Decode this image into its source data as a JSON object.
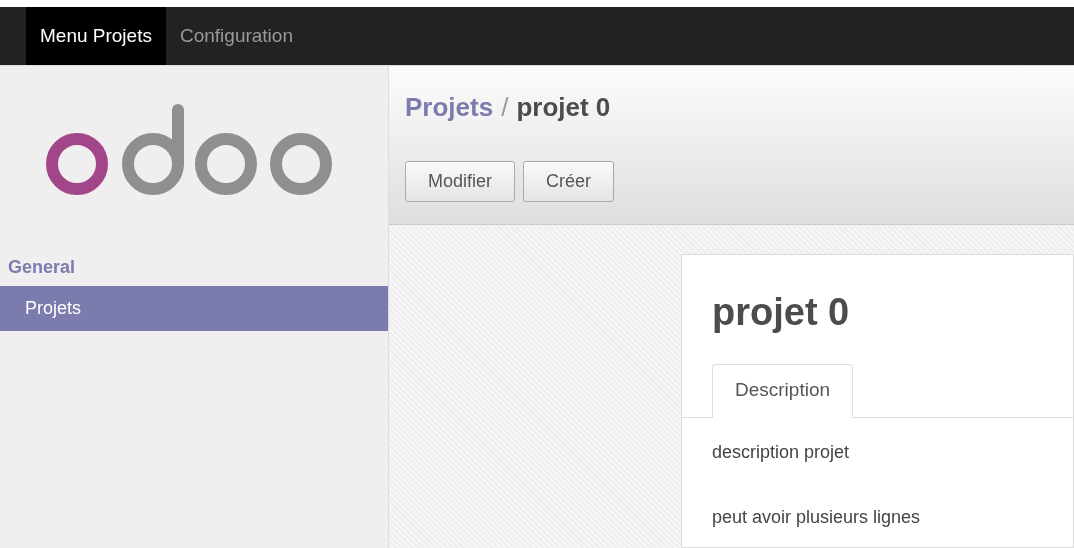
{
  "top_menu": [
    {
      "label": "Menu Projets",
      "selected": true
    },
    {
      "label": "Configuration",
      "selected": false
    }
  ],
  "sidebar": {
    "section": "General",
    "items": [
      {
        "label": "Projets",
        "selected": true
      }
    ]
  },
  "breadcrumb": {
    "parent": "Projets",
    "separator": "/",
    "current": "projet 0"
  },
  "buttons": [
    "Modifier",
    "Créer"
  ],
  "form": {
    "title": "projet 0",
    "tabs": [
      {
        "label": "Description",
        "selected": true
      }
    ],
    "lines": [
      "description projet",
      "peut avoir plusieurs lignes"
    ]
  }
}
